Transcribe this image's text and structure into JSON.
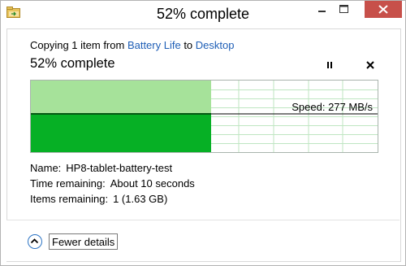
{
  "window": {
    "title": "52% complete"
  },
  "dialog": {
    "copy_prefix": "Copying 1 item from ",
    "source_link": "Battery Life",
    "copy_middle": " to ",
    "dest_link": "Desktop",
    "heading": "52% complete",
    "progress_fraction": 0.52
  },
  "graph": {
    "speed_label": "Speed:",
    "speed_value": "277 MB/s",
    "colors": {
      "fill_top": "#a6e29a",
      "fill_bottom": "#06b025",
      "grid": "#bfe6c2",
      "line": "#000000"
    }
  },
  "details": {
    "name_label": "Name:",
    "name_value": "HP8-tablet-battery-test",
    "time_label": "Time remaining:",
    "time_value": "About 10 seconds",
    "items_label": "Items remaining:",
    "items_value": "1 (1.63 GB)"
  },
  "footer": {
    "fewer_details": "Fewer details"
  },
  "icons": {
    "app": "copy-folder-icon",
    "minimize": "minimize-icon",
    "maximize": "maximize-icon",
    "close": "close-icon",
    "pause": "pause-icon",
    "stop": "stop-icon",
    "collapse": "chevron-up-icon"
  }
}
